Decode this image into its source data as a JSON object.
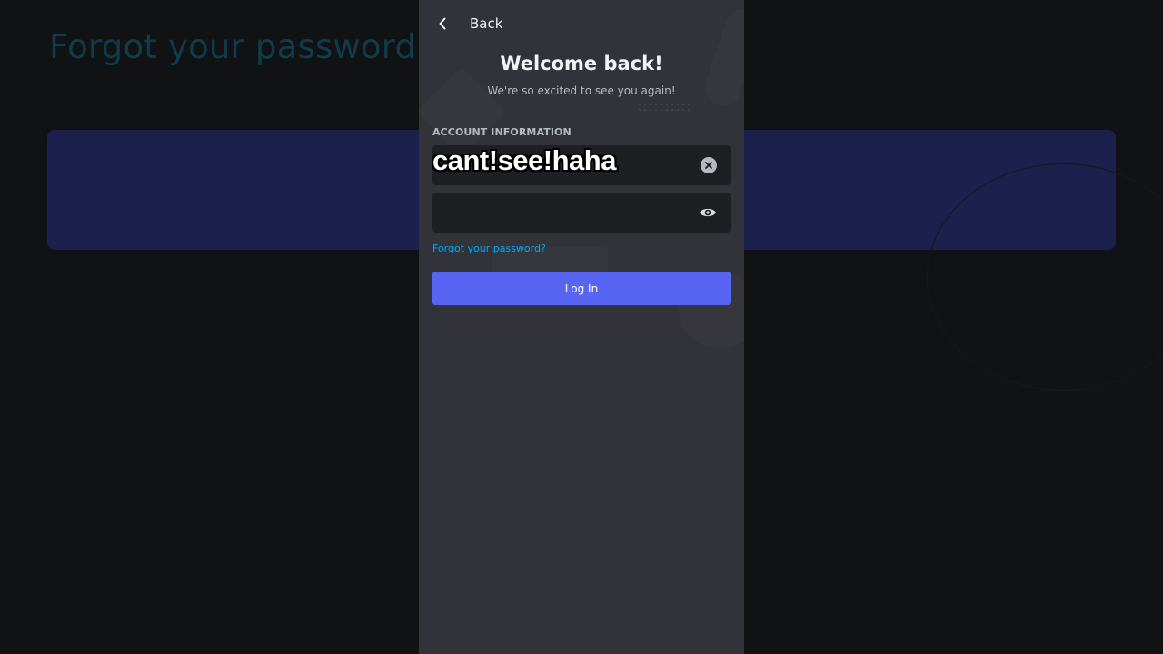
{
  "background": {
    "title": "Forgot your password?"
  },
  "header": {
    "back_label": "Back",
    "back_icon": "chevron-left-icon"
  },
  "main": {
    "title": "Welcome back!",
    "subtitle": "We're so excited to see you again!",
    "section_label": "ACCOUNT INFORMATION"
  },
  "form": {
    "username_value": "cant!see!haha",
    "username_clear_icon": "clear-circle-icon",
    "password_value": "",
    "password_visibility_icon": "eye-icon",
    "forgot_link": "Forgot your password?",
    "login_label": "Log In"
  },
  "colors": {
    "accent": "#5865f2",
    "link": "#00a8fc",
    "panel": "#313338",
    "input": "#1e1f22",
    "backdrop": "#111214"
  }
}
